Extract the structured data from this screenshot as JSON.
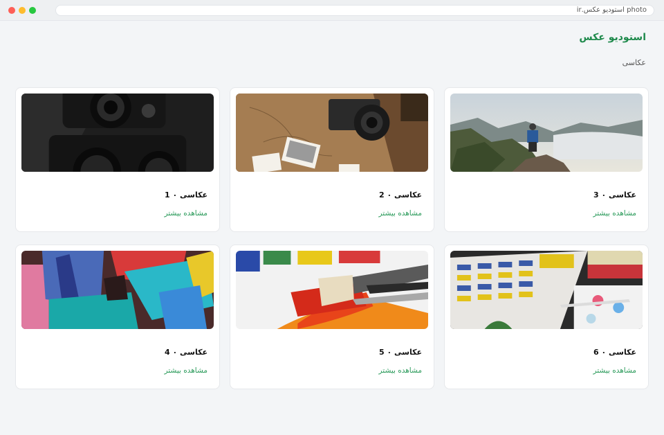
{
  "browser": {
    "url": "photo استودیو عکس.ir"
  },
  "header": {
    "site_title": "استودیو عکس",
    "category": "عکاسی"
  },
  "cards": [
    {
      "title": "عکاسی ۰ 3",
      "link": "مشاهده بیشتر",
      "image": "landscape-photographer-image"
    },
    {
      "title": "عکاسی ۰ 2",
      "link": "مشاهده بیشتر",
      "image": "camera-on-map-image"
    },
    {
      "title": "عکاسی ۰ 1",
      "link": "مشاهده بیشتر",
      "image": "dark-cameras-image"
    },
    {
      "title": "عکاسی ۰ 6",
      "link": "مشاهده بیشتر",
      "image": "color-swatches-image"
    },
    {
      "title": "عکاسی ۰ 5",
      "link": "مشاهده بیشتر",
      "image": "paintbrushes-on-paint-image"
    },
    {
      "title": "عکاسی ۰ 4",
      "link": "مشاهده بیشتر",
      "image": "colorful-brushes-image"
    }
  ],
  "colors": {
    "accent": "#1f8a4c",
    "link": "#2a9a5a",
    "background": "#f3f5f7"
  }
}
